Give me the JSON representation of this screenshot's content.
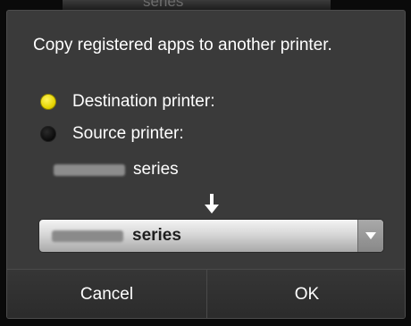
{
  "backdrop": {
    "partial_text": "series"
  },
  "dialog": {
    "message": "Copy registered apps to another printer.",
    "options": [
      {
        "label": "Destination printer:",
        "selected": true
      },
      {
        "label": "Source printer:",
        "selected": false
      }
    ],
    "source_model": {
      "suffix": "series"
    },
    "arrow_icon": "arrow-down-icon",
    "destination_select": {
      "selected_suffix": "series"
    },
    "buttons": {
      "cancel": "Cancel",
      "ok": "OK"
    }
  },
  "colors": {
    "radio_selected": "#e5d300",
    "dialog_background": "#3a3a3a",
    "button_bar": "#2f2f2f"
  }
}
